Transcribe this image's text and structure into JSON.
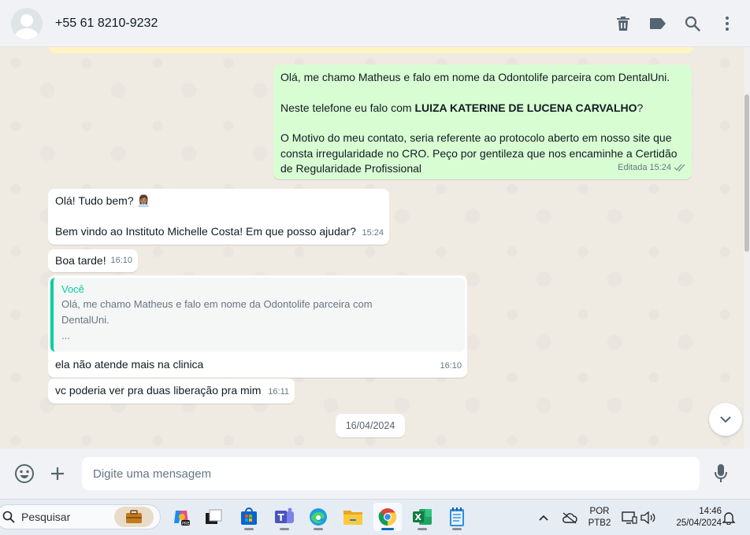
{
  "header": {
    "contact": "+55 61 8210-9232",
    "icons": [
      "delete-icon",
      "label-icon",
      "search-icon",
      "menu-icon"
    ]
  },
  "messages": {
    "m1": {
      "line1": "Olá, me chamo Matheus e falo em nome da Odontolife parceira com DentalUni.",
      "line2_pre": "Neste telefone eu falo com ",
      "line2_bold": "LUIZA KATERINE DE LUCENA CARVALHO",
      "line2_post": "?",
      "line3": "O Motivo do meu contato, seria referente ao protocolo aberto em nosso site que consta irregularidade no CRO. Peço por gentileza que nos encaminhe a Certidão de Regularidade Profissional",
      "status": "Editada",
      "time": "15:24"
    },
    "m2": {
      "line1": "Olá! Tudo bem? 👩🏽‍💼",
      "line2": "Bem vindo ao Instituto Michelle Costa! Em que posso ajudar?",
      "time": "15:24"
    },
    "m3": {
      "text": "Boa tarde!",
      "time": "16:10"
    },
    "m4": {
      "quote_author": "Você",
      "quote_text": "Olá, me chamo Matheus e falo em nome da Odontolife parceira com\nDentalUni.\n...",
      "text": "ela não atende mais na clinica",
      "time": "16:10"
    },
    "m5": {
      "text": "vc poderia ver pra duas liberação pra mim",
      "time": "16:11"
    }
  },
  "date_divider": "16/04/2024",
  "composer": {
    "placeholder": "Digite uma mensagem"
  },
  "taskbar": {
    "search_label": "Pesquisar",
    "lang_line1": "POR",
    "lang_line2": "PTB2",
    "time": "14:46",
    "date": "25/04/2024"
  },
  "colors": {
    "outgoing_bubble": "#d9fdd3",
    "incoming_bubble": "#ffffff",
    "chat_background": "#efeae2",
    "accent": "#06cf9c",
    "read_ticks": "#53bdeb"
  }
}
